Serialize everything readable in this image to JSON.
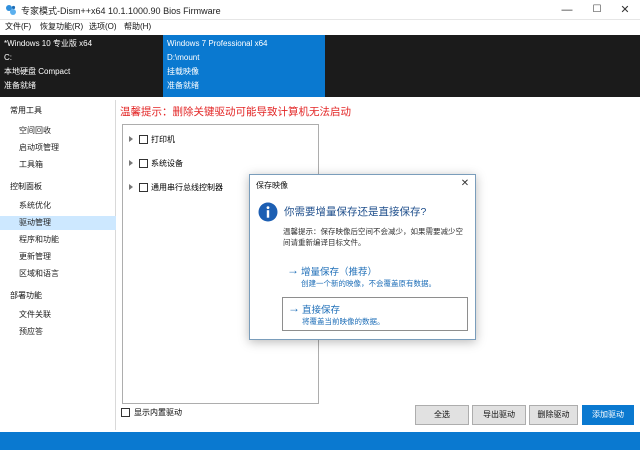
{
  "window": {
    "title": "专家模式-Dism++x64 10.1.1000.90 Bios Firmware",
    "minimize": "—",
    "maximize": "☐",
    "close": "✕"
  },
  "menu": [
    "文件(F)",
    "恢复功能(R)",
    "选项(O)",
    "帮助(H)"
  ],
  "images": [
    {
      "name": "*Windows 10 专业版 x64",
      "path": "C:",
      "type": "本地硬盘 Compact",
      "status": "准备就绪",
      "selected": false
    },
    {
      "name": "Windows 7 Professional x64",
      "path": "D:\\mount",
      "type": "挂载映像",
      "status": "准备就绪",
      "selected": true
    }
  ],
  "sidebar": {
    "groups": [
      {
        "label": "常用工具",
        "items": [
          "空间回收",
          "启动项管理",
          "工具箱"
        ]
      },
      {
        "label": "控制面板",
        "items": [
          "系统优化",
          "驱动管理",
          "程序和功能",
          "更新管理",
          "区域和语言"
        ]
      },
      {
        "label": "部署功能",
        "items": [
          "文件关联",
          "预应答"
        ]
      }
    ],
    "active_item": "驱动管理"
  },
  "main": {
    "warning": "温馨提示：删除关键驱动可能导致计算机无法启动",
    "tree": [
      "打印机",
      "系统设备",
      "通用串行总线控制器"
    ],
    "show_builtin_label": "显示内置驱动",
    "buttons": {
      "select_all": "全选",
      "export": "导出驱动",
      "delete": "删除驱动",
      "add": "添加驱动"
    }
  },
  "dialog": {
    "title": "保存映像",
    "close": "✕",
    "heading": "你需要增量保存还是直接保存?",
    "description": "温馨提示：保存映像后空间不会减少，如果需要减少空间请重新编译目标文件。",
    "options": [
      {
        "arrow": "→",
        "label": "增量保存（推荐）",
        "desc": "创建一个新的映像，不会覆盖原有数据。"
      },
      {
        "arrow": "→",
        "label": "直接保存",
        "desc": "将覆盖当前映像的数据。"
      }
    ]
  },
  "colors": {
    "accent": "#0a79d0",
    "warning": "#e32626",
    "link": "#1f6fb8",
    "dark_band": "#1b1b1b",
    "selection": "#cde8ff"
  },
  "icons": {
    "app": "dism-gear-icon",
    "dialog": "info-icon",
    "tree_expand": "expand-arrow-icon"
  }
}
